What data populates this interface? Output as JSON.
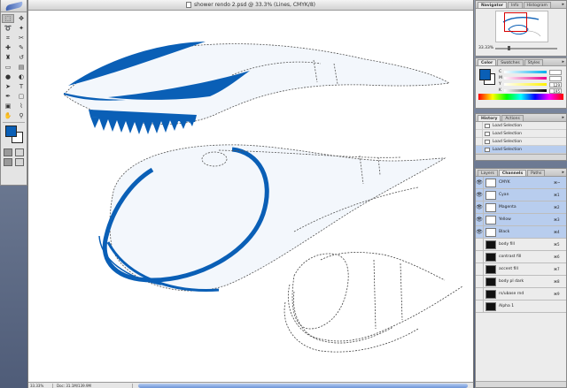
{
  "document": {
    "title": "shower rendo 2.psd @ 33.3% (Lines, CMYK/8)",
    "zoom": "33.33%",
    "doc_size": "Doc: 31.1M/139.9M"
  },
  "colors": {
    "accent_blue": "#0a5fb6",
    "selection": "#b8cdee"
  },
  "toolbox": {
    "tools": [
      {
        "icon": "marquee-icon",
        "glyph": "⬚"
      },
      {
        "icon": "move-icon",
        "glyph": "✥"
      },
      {
        "icon": "lasso-icon",
        "glyph": "➰"
      },
      {
        "icon": "magic-wand-icon",
        "glyph": "✦"
      },
      {
        "icon": "crop-icon",
        "glyph": "⌗"
      },
      {
        "icon": "slice-icon",
        "glyph": "✂"
      },
      {
        "icon": "healing-brush-icon",
        "glyph": "✚"
      },
      {
        "icon": "brush-icon",
        "glyph": "✎"
      },
      {
        "icon": "stamp-icon",
        "glyph": "♜"
      },
      {
        "icon": "history-brush-icon",
        "glyph": "↺"
      },
      {
        "icon": "eraser-icon",
        "glyph": "▭"
      },
      {
        "icon": "gradient-icon",
        "glyph": "▤"
      },
      {
        "icon": "blur-icon",
        "glyph": "●"
      },
      {
        "icon": "dodge-icon",
        "glyph": "◐"
      },
      {
        "icon": "path-select-icon",
        "glyph": "➤"
      },
      {
        "icon": "type-icon",
        "glyph": "T"
      },
      {
        "icon": "pen-icon",
        "glyph": "✒"
      },
      {
        "icon": "shape-icon",
        "glyph": "▢"
      },
      {
        "icon": "notes-icon",
        "glyph": "▣"
      },
      {
        "icon": "eyedropper-icon",
        "glyph": "⌇"
      },
      {
        "icon": "hand-icon",
        "glyph": "✋"
      },
      {
        "icon": "zoom-icon",
        "glyph": "⚲"
      }
    ]
  },
  "navigator": {
    "tabs": [
      "Navigator",
      "Info",
      "Histogram"
    ],
    "zoom": "33.33%"
  },
  "color_palette": {
    "tabs": [
      "Color",
      "Swatches",
      "Styles"
    ],
    "channels": [
      {
        "label": "C",
        "value": "",
        "gradient": "linear-gradient(90deg,#fff,#00aeef)"
      },
      {
        "label": "M",
        "value": "",
        "gradient": "linear-gradient(90deg,#fff,#ec008c)"
      },
      {
        "label": "Y",
        "value": "129",
        "gradient": "linear-gradient(90deg,#fff,#fff200)"
      },
      {
        "label": "K",
        "value": "195",
        "gradient": "linear-gradient(90deg,#fff,#000)"
      }
    ]
  },
  "history": {
    "tabs": [
      "History",
      "Actions"
    ],
    "items": [
      "Load Selection",
      "Load Selection",
      "Load Selection",
      "Load Selection"
    ]
  },
  "channels": {
    "tabs": [
      "Layers",
      "Channels",
      "Paths"
    ],
    "rows": [
      {
        "name": "CMYK",
        "shortcut": "⌘~",
        "selected": true,
        "visible": true,
        "dark": false
      },
      {
        "name": "Cyan",
        "shortcut": "⌘1",
        "selected": true,
        "visible": true,
        "dark": false
      },
      {
        "name": "Magenta",
        "shortcut": "⌘2",
        "selected": true,
        "visible": true,
        "dark": false
      },
      {
        "name": "Yellow",
        "shortcut": "⌘3",
        "selected": true,
        "visible": true,
        "dark": false
      },
      {
        "name": "Black",
        "shortcut": "⌘4",
        "selected": true,
        "visible": true,
        "dark": false
      },
      {
        "name": "body fill",
        "shortcut": "⌘5",
        "selected": false,
        "visible": false,
        "dark": true
      },
      {
        "name": "contrast fill",
        "shortcut": "⌘6",
        "selected": false,
        "visible": false,
        "dark": true
      },
      {
        "name": "accent fill",
        "shortcut": "⌘7",
        "selected": false,
        "visible": false,
        "dark": true
      },
      {
        "name": "body pl dark",
        "shortcut": "⌘8",
        "selected": false,
        "visible": false,
        "dark": true
      },
      {
        "name": "rs/ubase rnd",
        "shortcut": "⌘9",
        "selected": false,
        "visible": false,
        "dark": true
      },
      {
        "name": "Alpha 1",
        "shortcut": "",
        "selected": false,
        "visible": false,
        "dark": true
      }
    ]
  }
}
